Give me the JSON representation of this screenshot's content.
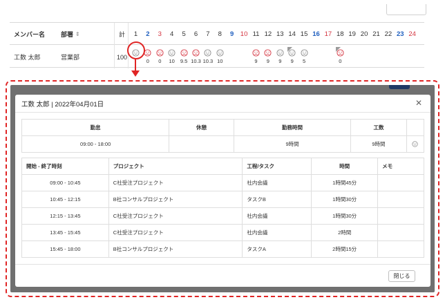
{
  "grid": {
    "headers": {
      "member_name": "メンバー名",
      "department": "部署",
      "total": "計"
    },
    "days": [
      {
        "label": "1",
        "type": "normal"
      },
      {
        "label": "2",
        "type": "sat"
      },
      {
        "label": "3",
        "type": "sun"
      },
      {
        "label": "4",
        "type": "normal"
      },
      {
        "label": "5",
        "type": "normal"
      },
      {
        "label": "6",
        "type": "normal"
      },
      {
        "label": "7",
        "type": "normal"
      },
      {
        "label": "8",
        "type": "normal"
      },
      {
        "label": "9",
        "type": "sat"
      },
      {
        "label": "10",
        "type": "sun"
      },
      {
        "label": "11",
        "type": "normal"
      },
      {
        "label": "12",
        "type": "normal"
      },
      {
        "label": "13",
        "type": "normal"
      },
      {
        "label": "14",
        "type": "normal"
      },
      {
        "label": "15",
        "type": "normal"
      },
      {
        "label": "16",
        "type": "sat"
      },
      {
        "label": "17",
        "type": "sun"
      },
      {
        "label": "18",
        "type": "normal"
      },
      {
        "label": "19",
        "type": "normal"
      },
      {
        "label": "20",
        "type": "normal"
      },
      {
        "label": "21",
        "type": "normal"
      },
      {
        "label": "22",
        "type": "normal"
      },
      {
        "label": "23",
        "type": "sat"
      },
      {
        "label": "24",
        "type": "sun"
      }
    ],
    "row": {
      "name": "工数 太郎",
      "department": "営業部",
      "total": "100",
      "cells": [
        {
          "face": "gray",
          "value": ""
        },
        {
          "face": "red",
          "value": "0"
        },
        {
          "face": "red",
          "value": "0"
        },
        {
          "face": "gray",
          "value": "10"
        },
        {
          "face": "red",
          "value": "9.5"
        },
        {
          "face": "red",
          "value": "10.3"
        },
        {
          "face": "gray",
          "value": "10.3"
        },
        {
          "face": "gray",
          "value": "10"
        },
        {
          "face": "",
          "value": ""
        },
        {
          "face": "",
          "value": ""
        },
        {
          "face": "red",
          "value": "9"
        },
        {
          "face": "red",
          "value": "9"
        },
        {
          "face": "gray",
          "value": "9"
        },
        {
          "face": "gray",
          "value": "9",
          "flag": true
        },
        {
          "face": "gray",
          "value": "5"
        },
        {
          "face": "",
          "value": ""
        },
        {
          "face": "",
          "value": ""
        },
        {
          "face": "red",
          "value": "0",
          "flag": true
        },
        {
          "face": "",
          "value": ""
        },
        {
          "face": "",
          "value": ""
        },
        {
          "face": "",
          "value": ""
        },
        {
          "face": "",
          "value": ""
        },
        {
          "face": "",
          "value": ""
        },
        {
          "face": "",
          "value": ""
        }
      ]
    }
  },
  "modal": {
    "title": "工数 太郎 | 2022年04月01日",
    "summary": {
      "headers": [
        "勤怠",
        "休憩",
        "勤務時間",
        "工数"
      ],
      "attendance": "09:00 - 18:00",
      "break": "",
      "work_hours": "9時間",
      "man_hours": "9時間"
    },
    "detail": {
      "headers": [
        "開始 - 終了時刻",
        "プロジェクト",
        "工程/タスク",
        "時間",
        "メモ"
      ],
      "rows": [
        {
          "time": "09:00 - 10:45",
          "project": "C社受注プロジェクト",
          "task": "社内会議",
          "hours": "1時間45分",
          "memo": ""
        },
        {
          "time": "10:45 - 12:15",
          "project": "B社コンサルプロジェクト",
          "task": "タスクB",
          "hours": "1時間30分",
          "memo": ""
        },
        {
          "time": "12:15 - 13:45",
          "project": "C社受注プロジェクト",
          "task": "社内会議",
          "hours": "1時間30分",
          "memo": ""
        },
        {
          "time": "13:45 - 15:45",
          "project": "C社受注プロジェクト",
          "task": "社内会議",
          "hours": "2時間",
          "memo": ""
        },
        {
          "time": "15:45 - 18:00",
          "project": "B社コンサルプロジェクト",
          "task": "タスクA",
          "hours": "2時間15分",
          "memo": ""
        }
      ]
    },
    "close_label": "閉じる"
  },
  "colors": {
    "highlight": "#e02424",
    "link": "#2462b5",
    "saturday": "#1f5fbf",
    "sunday": "#d4323e",
    "face_red": "#d4323e",
    "face_gray": "#8a8a8a"
  }
}
